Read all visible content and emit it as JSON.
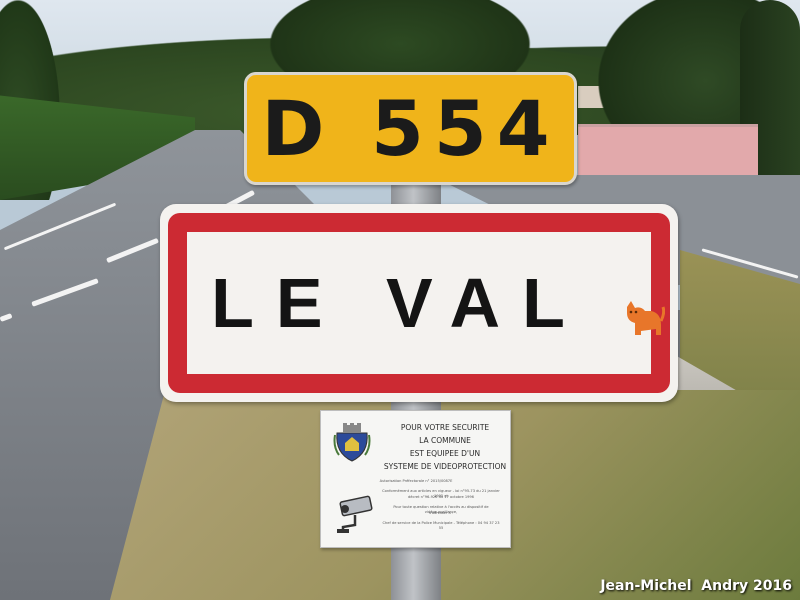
{
  "road_sign": {
    "route_number": "D 554"
  },
  "town_sign": {
    "name": "LE VAL",
    "border_color": "#cc2a33",
    "sticker": "cat-sticker-icon"
  },
  "notice_board": {
    "lines": [
      "POUR VOTRE SECURITE",
      "LA COMMUNE",
      "EST EQUIPEE D'UN",
      "SYSTEME DE VIDEOPROTECTION"
    ],
    "small_lines": [
      "Autorisation Préfectorale n° 2015/0087E",
      "Conformément aux articles en vigueur - loi n°95-73 du 21 janvier 1995 et",
      "décret n°96-926 du 17 octobre 1996",
      "Pour toute question relative à l'accès au dispositif de vidéosurveillance,",
      "s'adresser à :",
      "Chef de service de la Police Municipale - Téléphone : 04 94 37 23 55"
    ],
    "icons": [
      "coat-of-arms-icon",
      "cctv-camera-icon"
    ]
  },
  "photo_credit": "Jean-Michel  Andry 2016"
}
